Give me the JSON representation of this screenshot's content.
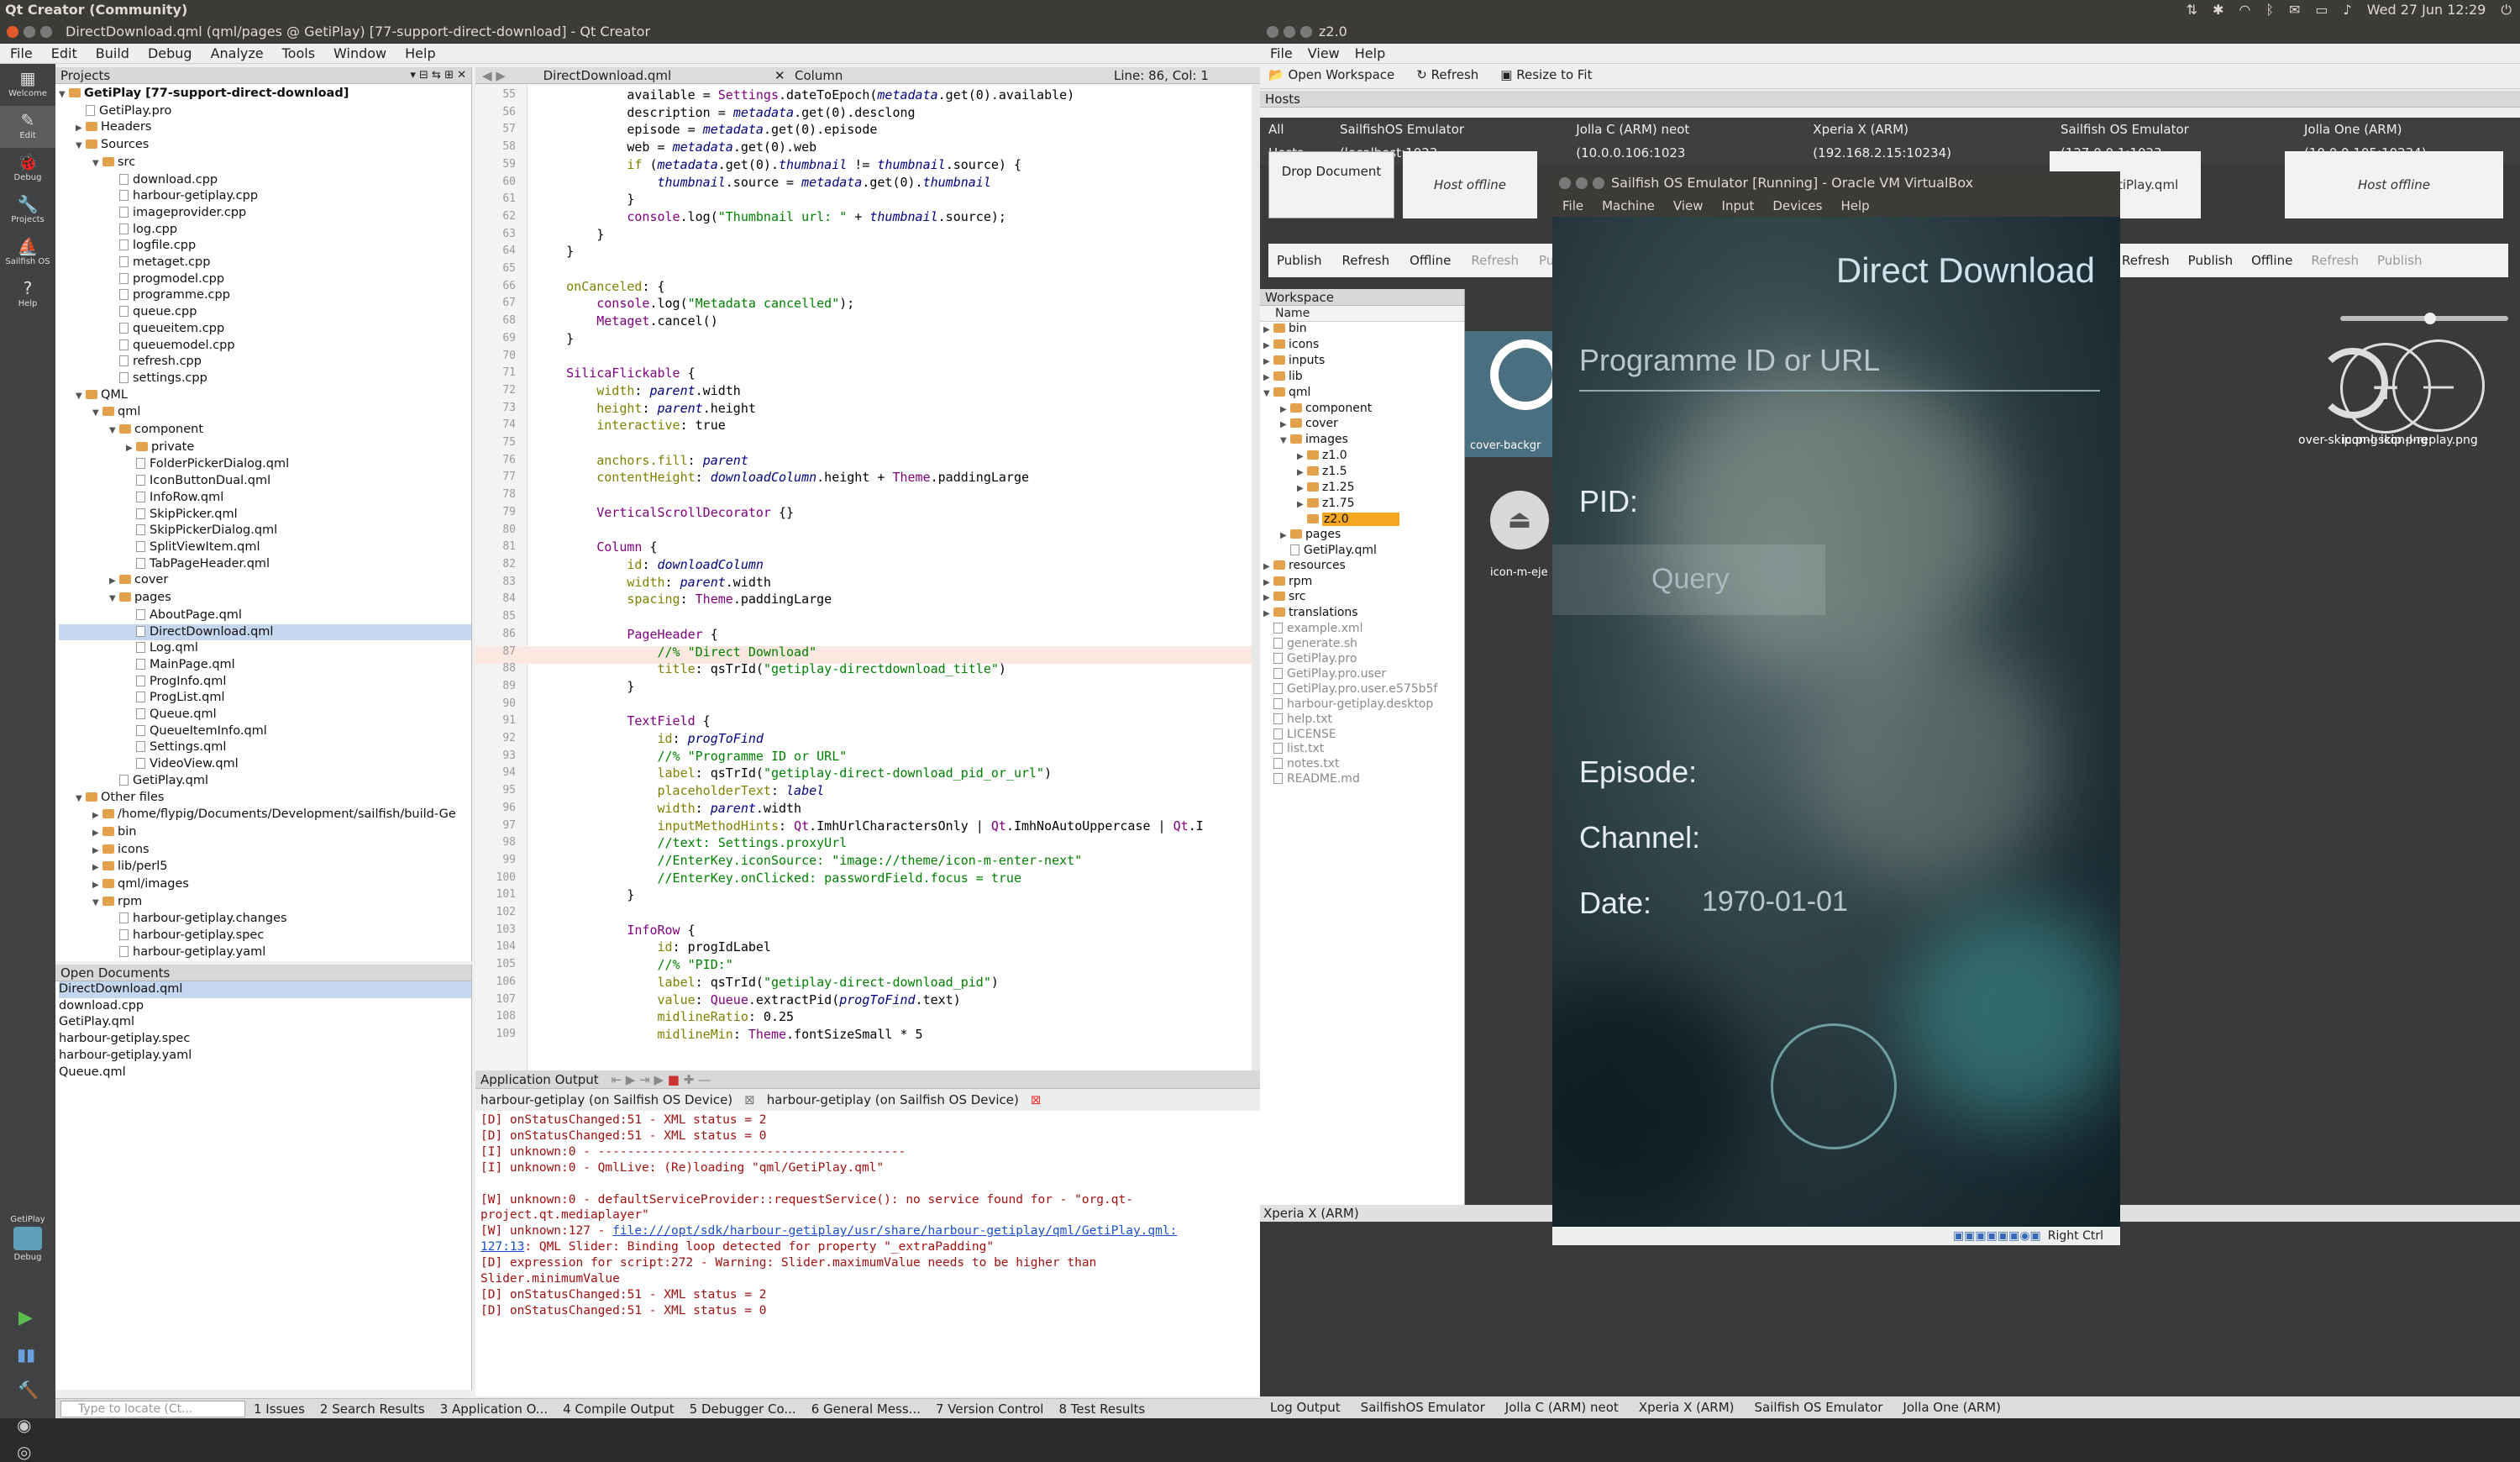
{
  "topbar": {
    "app": "Qt Creator (Community)",
    "clock": "Wed 27 Jun 12:29"
  },
  "qtc": {
    "title": "DirectDownload.qml (qml/pages @ GetiPlay) [77-support-direct-download] - Qt Creator",
    "menu": [
      "File",
      "Edit",
      "Build",
      "Debug",
      "Analyze",
      "Tools",
      "Window",
      "Help"
    ],
    "modes": [
      {
        "icon": "grid-icon",
        "label": "Welcome"
      },
      {
        "icon": "edit-icon",
        "label": "Edit"
      },
      {
        "icon": "debug-icon",
        "label": "Debug"
      },
      {
        "icon": "wrench-icon",
        "label": "Projects"
      },
      {
        "icon": "sailfish-icon",
        "label": "Sailfish OS"
      },
      {
        "icon": "help-icon",
        "label": "Help"
      }
    ],
    "kit_label": "GetiPlay",
    "kit_mode": "Debug",
    "projects_header": "Projects",
    "tree": [
      [
        0,
        "open",
        "proj",
        "GetiPlay [77-support-direct-download]"
      ],
      [
        1,
        "",
        "file",
        "GetiPlay.pro"
      ],
      [
        1,
        "closed",
        "folder",
        "Headers"
      ],
      [
        1,
        "open",
        "folder",
        "Sources"
      ],
      [
        2,
        "open",
        "folder",
        "src"
      ],
      [
        3,
        "",
        "file",
        "download.cpp"
      ],
      [
        3,
        "",
        "file",
        "harbour-getiplay.cpp"
      ],
      [
        3,
        "",
        "file",
        "imageprovider.cpp"
      ],
      [
        3,
        "",
        "file",
        "log.cpp"
      ],
      [
        3,
        "",
        "file",
        "logfile.cpp"
      ],
      [
        3,
        "",
        "file",
        "metaget.cpp"
      ],
      [
        3,
        "",
        "file",
        "progmodel.cpp"
      ],
      [
        3,
        "",
        "file",
        "programme.cpp"
      ],
      [
        3,
        "",
        "file",
        "queue.cpp"
      ],
      [
        3,
        "",
        "file",
        "queueitem.cpp"
      ],
      [
        3,
        "",
        "file",
        "queuemodel.cpp"
      ],
      [
        3,
        "",
        "file",
        "refresh.cpp"
      ],
      [
        3,
        "",
        "file",
        "settings.cpp"
      ],
      [
        1,
        "open",
        "folder",
        "QML"
      ],
      [
        2,
        "open",
        "folder",
        "qml"
      ],
      [
        3,
        "open",
        "folder",
        "component"
      ],
      [
        4,
        "closed",
        "folder",
        "private"
      ],
      [
        4,
        "",
        "file",
        "FolderPickerDialog.qml"
      ],
      [
        4,
        "",
        "file",
        "IconButtonDual.qml"
      ],
      [
        4,
        "",
        "file",
        "InfoRow.qml"
      ],
      [
        4,
        "",
        "file",
        "SkipPicker.qml"
      ],
      [
        4,
        "",
        "file",
        "SkipPickerDialog.qml"
      ],
      [
        4,
        "",
        "file",
        "SplitViewItem.qml"
      ],
      [
        4,
        "",
        "file",
        "TabPageHeader.qml"
      ],
      [
        3,
        "closed",
        "folder",
        "cover"
      ],
      [
        3,
        "open",
        "folder",
        "pages"
      ],
      [
        4,
        "",
        "file",
        "AboutPage.qml"
      ],
      [
        4,
        "sel",
        "file",
        "DirectDownload.qml"
      ],
      [
        4,
        "",
        "file",
        "Log.qml"
      ],
      [
        4,
        "",
        "file",
        "MainPage.qml"
      ],
      [
        4,
        "",
        "file",
        "ProgInfo.qml"
      ],
      [
        4,
        "",
        "file",
        "ProgList.qml"
      ],
      [
        4,
        "",
        "file",
        "Queue.qml"
      ],
      [
        4,
        "",
        "file",
        "QueueItemInfo.qml"
      ],
      [
        4,
        "",
        "file",
        "Settings.qml"
      ],
      [
        4,
        "",
        "file",
        "VideoView.qml"
      ],
      [
        3,
        "",
        "file",
        "GetiPlay.qml"
      ],
      [
        1,
        "open",
        "folder",
        "Other files"
      ],
      [
        2,
        "closed",
        "folder",
        "/home/flypig/Documents/Development/sailfish/build-Ge"
      ],
      [
        2,
        "closed",
        "folder",
        "bin"
      ],
      [
        2,
        "closed",
        "folder",
        "icons"
      ],
      [
        2,
        "closed",
        "folder",
        "lib/perl5"
      ],
      [
        2,
        "closed",
        "folder",
        "qml/images"
      ],
      [
        2,
        "open",
        "folder",
        "rpm"
      ],
      [
        3,
        "",
        "file",
        "harbour-getiplay.changes"
      ],
      [
        3,
        "",
        "file",
        "harbour-getiplay.spec"
      ],
      [
        3,
        "",
        "file",
        "harbour-getiplay.yaml"
      ]
    ],
    "open_docs_header": "Open Documents",
    "open_docs": [
      "DirectDownload.qml",
      "download.cpp",
      "GetiPlay.qml",
      "harbour-getiplay.spec",
      "harbour-getiplay.yaml",
      "Queue.qml"
    ],
    "editor_tab": "DirectDownload.qml",
    "editor_symbol": "Column",
    "editor_pos": "Line: 86, Col: 1",
    "line_start": 55,
    "code": [
      "            available = Settings.dateToEpoch(metadata.get(0).available)",
      "            description = metadata.get(0).desclong",
      "            episode = metadata.get(0).episode",
      "            web = metadata.get(0).web",
      "            if (metadata.get(0).thumbnail != thumbnail.source) {",
      "                thumbnail.source = metadata.get(0).thumbnail",
      "            }",
      "            console.log(\"Thumbnail url: \" + thumbnail.source);",
      "        }",
      "    }",
      "",
      "    onCanceled: {",
      "        console.log(\"Metadata cancelled\");",
      "        Metaget.cancel()",
      "    }",
      "",
      "    SilicaFlickable {",
      "        width: parent.width",
      "        height: parent.height",
      "        interactive: true",
      "",
      "        anchors.fill: parent",
      "        contentHeight: downloadColumn.height + Theme.paddingLarge",
      "",
      "        VerticalScrollDecorator {}",
      "",
      "        Column {",
      "            id: downloadColumn",
      "            width: parent.width",
      "            spacing: Theme.paddingLarge",
      "",
      "            PageHeader {",
      "                //% \"Direct Download\"",
      "                title: qsTrId(\"getiplay-directdownload_title\")",
      "            }",
      "",
      "            TextField {",
      "                id: progToFind",
      "                //% \"Programme ID or URL\"",
      "                label: qsTrId(\"getiplay-direct-download_pid_or_url\")",
      "                placeholderText: label",
      "                width: parent.width",
      "                inputMethodHints: Qt.ImhUrlCharactersOnly | Qt.ImhNoAutoUppercase | Qt.I",
      "                //text: Settings.proxyUrl",
      "                //EnterKey.iconSource: \"image://theme/icon-m-enter-next\"",
      "                //EnterKey.onClicked: passwordField.focus = true",
      "            }",
      "",
      "            InfoRow {",
      "                id: progIdLabel",
      "                //% \"PID:\"",
      "                label: qsTrId(\"getiplay-direct-download_pid\")",
      "                value: Queue.extractPid(progToFind.text)",
      "                midlineRatio: 0.25",
      "                midlineMin: Theme.fontSizeSmall * 5"
    ],
    "app_output_header": "Application Output",
    "output_tabs": [
      "harbour-getiplay (on Sailfish OS Device)",
      "harbour-getiplay (on Sailfish OS Device)"
    ],
    "output": [
      "[D] onStatusChanged:51 - XML status = 2",
      "[D] onStatusChanged:51 - XML status = 0",
      "[I] unknown:0 - ------------------------------------------",
      "[I] unknown:0 - QmlLive: (Re)loading \"qml/GetiPlay.qml\"",
      "",
      "[W] unknown:0 - defaultServiceProvider::requestService(): no service found for - \"org.qt-",
      "project.qt.mediaplayer\"",
      "[W] unknown:127 - file:///opt/sdk/harbour-getiplay/usr/share/harbour-getiplay/qml/GetiPlay.qml:",
      "127:13: QML Slider: Binding loop detected for property \"_extraPadding\"",
      "[D] expression for script:272 - Warning: Slider.maximumValue needs to be higher than",
      "Slider.minimumValue",
      "[D] onStatusChanged:51 - XML status = 2",
      "[D] onStatusChanged:51 - XML status = 0"
    ],
    "locator_placeholder": "Type to locate (Ct...",
    "bottom_tabs": [
      "1 Issues",
      "2 Search Results",
      "3 Application O...",
      "4 Compile Output",
      "5 Debugger Co...",
      "6 General Mess...",
      "7 Version Control",
      "8 Test Results"
    ]
  },
  "qmllive": {
    "title": "z2.0",
    "menu": [
      "File",
      "View",
      "Help"
    ],
    "toolbar": [
      "Open Workspace",
      "Refresh",
      "Resize to Fit"
    ],
    "hosts_header": "Hosts",
    "host_tabs": [
      "All Hosts",
      "SailfishOS Emulator (localhost:1023",
      "Jolla C (ARM) neot (10.0.0.106:1023",
      "Xperia X (ARM) (192.168.2.15:10234)",
      "Sailfish OS Emulator (127.0.0.1:1023",
      "Jolla One (ARM) (10.0.0.105:10234)"
    ],
    "drop": "Drop Document",
    "host_offline": "Host offline",
    "host_file": "qml/GetiPlay.qml",
    "actions": {
      "publish": "Publish",
      "refresh": "Refresh",
      "offline": "Offline",
      "pub_short": "Pub"
    },
    "workspace_header": "Workspace",
    "name_col": "Name",
    "ws_tree": [
      [
        0,
        "closed",
        "folder",
        "bin"
      ],
      [
        0,
        "closed",
        "folder",
        "icons"
      ],
      [
        0,
        "closed",
        "folder",
        "inputs"
      ],
      [
        0,
        "closed",
        "folder",
        "lib"
      ],
      [
        0,
        "open",
        "folder",
        "qml"
      ],
      [
        1,
        "closed",
        "folder",
        "component"
      ],
      [
        1,
        "closed",
        "folder",
        "cover"
      ],
      [
        1,
        "open",
        "folder",
        "images"
      ],
      [
        2,
        "closed",
        "folder",
        "z1.0"
      ],
      [
        2,
        "closed",
        "folder",
        "z1.5"
      ],
      [
        2,
        "closed",
        "folder",
        "z1.25"
      ],
      [
        2,
        "closed",
        "folder",
        "z1.75"
      ],
      [
        2,
        "hl",
        "folder",
        "z2.0"
      ],
      [
        1,
        "closed",
        "folder",
        "pages"
      ],
      [
        1,
        "",
        "file",
        "GetiPlay.qml"
      ],
      [
        0,
        "closed",
        "folder",
        "resources"
      ],
      [
        0,
        "closed",
        "folder",
        "rpm"
      ],
      [
        0,
        "closed",
        "folder",
        "src"
      ],
      [
        0,
        "closed",
        "folder",
        "translations"
      ],
      [
        0,
        "",
        "grey",
        "example.xml"
      ],
      [
        0,
        "",
        "grey",
        "generate.sh"
      ],
      [
        0,
        "",
        "grey",
        "GetiPlay.pro"
      ],
      [
        0,
        "",
        "grey",
        "GetiPlay.pro.user"
      ],
      [
        0,
        "",
        "grey",
        "GetiPlay.pro.user.e575b5f"
      ],
      [
        0,
        "",
        "grey",
        "harbour-getiplay.desktop"
      ],
      [
        0,
        "",
        "grey",
        "help.txt"
      ],
      [
        0,
        "",
        "grey",
        "LICENSE"
      ],
      [
        0,
        "",
        "grey",
        "list.txt"
      ],
      [
        0,
        "",
        "grey",
        "notes.txt"
      ],
      [
        0,
        "",
        "grey",
        "README.md"
      ]
    ],
    "images": [
      "cover-backgr",
      "icon-m-eje",
      "over-skip.png",
      "icon-l-replay.png",
      "icon-l-skip.png"
    ],
    "device_pane": "Xperia X (ARM)",
    "status_tabs": [
      "Log Output",
      "SailfishOS Emulator",
      "Jolla C (ARM) neot",
      "Xperia X (ARM)",
      "Sailfish OS Emulator",
      "Jolla One (ARM)"
    ]
  },
  "vm": {
    "title": "Sailfish OS Emulator [Running] - Oracle VM VirtualBox",
    "menu": [
      "File",
      "Machine",
      "View",
      "Input",
      "Devices",
      "Help"
    ],
    "page_title": "Direct Download",
    "field_placeholder": "Programme ID or URL",
    "pid": "PID:",
    "query": "Query",
    "episode": "Episode:",
    "channel": "Channel:",
    "date": "Date:",
    "date_value": "1970-01-01",
    "host_key": "Right Ctrl"
  },
  "colors": {
    "dark_bar": "#3c3b37",
    "qt_side": "#404244",
    "highlight": "#f5a623",
    "sailfish_text": "#e6edf0"
  }
}
